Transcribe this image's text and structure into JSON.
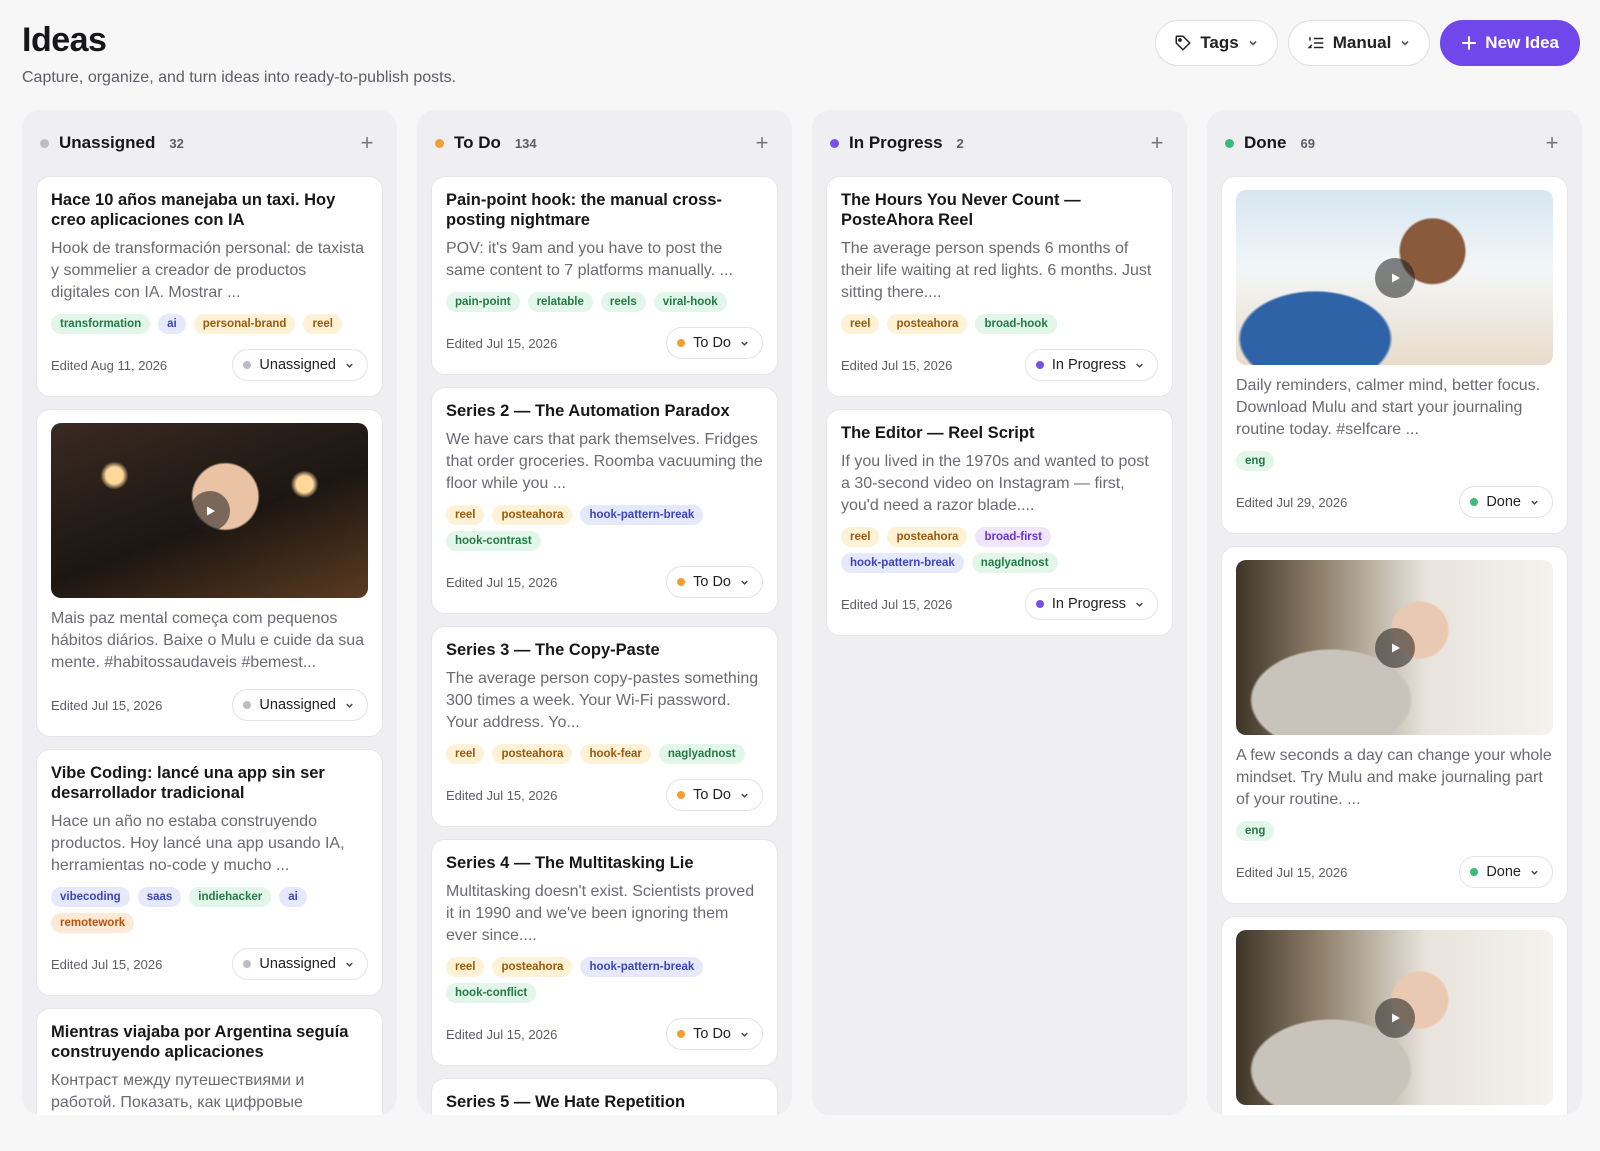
{
  "page": {
    "title": "Ideas",
    "subtitle": "Capture, organize, and turn ideas into ready-to-publish posts."
  },
  "toolbar": {
    "tags_label": "Tags",
    "sort_label": "Manual",
    "new_label": "New Idea"
  },
  "colors": {
    "accent": "#7047eb",
    "unassigned": "#bdbdc4",
    "todo": "#f0a030",
    "inprogress": "#7a4fe8",
    "done": "#3cba78"
  },
  "columns": [
    {
      "title": "Unassigned",
      "count": "32",
      "color": "#bdbdc4",
      "cards": [
        {
          "title": "Hace 10 años manejaba un taxi. Hoy creo aplicaciones con IA",
          "body": "Hook de transformación personal: de taxista y sommelier a creador de productos digitales con IA. Mostrar ...",
          "tags": [
            {
              "t": "transformation",
              "c": "green"
            },
            {
              "t": "ai",
              "c": "blue"
            },
            {
              "t": "personal-brand",
              "c": "yellow"
            },
            {
              "t": "reel",
              "c": "yellow"
            }
          ],
          "edited": "Edited Aug 11, 2026",
          "status": "Unassigned"
        },
        {
          "media": "dinner",
          "body": "Mais paz mental começa com pequenos hábitos diários. Baixe o Mulu e cuide da sua mente. #habitossaudaveis #bemest...",
          "tags": [],
          "edited": "Edited Jul 15, 2026",
          "status": "Unassigned"
        },
        {
          "title": "Vibe Coding: lancé una app sin ser desarrollador tradicional",
          "body": "Hace un año no estaba construyendo productos. Hoy lancé una app usando IA, herramientas no-code y mucho ...",
          "tags": [
            {
              "t": "vibecoding",
              "c": "blue"
            },
            {
              "t": "saas",
              "c": "blue"
            },
            {
              "t": "indiehacker",
              "c": "green"
            },
            {
              "t": "ai",
              "c": "blue"
            },
            {
              "t": "remotework",
              "c": "orange"
            }
          ],
          "edited": "Edited Jul 15, 2026",
          "status": "Unassigned"
        },
        {
          "title": "Mientras viajaba por Argentina seguía construyendo aplicaciones",
          "body": "Контраст между путешествиями и работой. Показать, как цифровые",
          "tags": [],
          "edited": "",
          "status": ""
        }
      ]
    },
    {
      "title": "To Do",
      "count": "134",
      "color": "#f0a030",
      "cards": [
        {
          "title": "Pain-point hook: the manual cross-posting nightmare",
          "body": "POV: it's 9am and you have to post the same content to 7 platforms manually. ...",
          "tags": [
            {
              "t": "pain-point",
              "c": "green"
            },
            {
              "t": "relatable",
              "c": "green"
            },
            {
              "t": "reels",
              "c": "green"
            },
            {
              "t": "viral-hook",
              "c": "green"
            }
          ],
          "edited": "Edited Jul 15, 2026",
          "status": "To Do"
        },
        {
          "title": "Series 2 — The Automation Paradox",
          "body": "We have cars that park themselves. Fridges that order groceries. Roomba vacuuming the floor while you ...",
          "tags": [
            {
              "t": "reel",
              "c": "yellow"
            },
            {
              "t": "posteahora",
              "c": "yellow"
            },
            {
              "t": "hook-pattern-break",
              "c": "blue"
            },
            {
              "t": "hook-contrast",
              "c": "green"
            }
          ],
          "edited": "Edited Jul 15, 2026",
          "status": "To Do"
        },
        {
          "title": "Series 3 — The Copy-Paste",
          "body": "The average person copy-pastes something 300 times a week. Your Wi-Fi password. Your address. Yo...",
          "tags": [
            {
              "t": "reel",
              "c": "yellow"
            },
            {
              "t": "posteahora",
              "c": "yellow"
            },
            {
              "t": "hook-fear",
              "c": "yellow"
            },
            {
              "t": "naglyadnost",
              "c": "green"
            }
          ],
          "edited": "Edited Jul 15, 2026",
          "status": "To Do"
        },
        {
          "title": "Series 4 — The Multitasking Lie",
          "body": "Multitasking doesn't exist. Scientists proved it in 1990 and we've been ignoring them ever since....",
          "tags": [
            {
              "t": "reel",
              "c": "yellow"
            },
            {
              "t": "posteahora",
              "c": "yellow"
            },
            {
              "t": "hook-pattern-break",
              "c": "blue"
            },
            {
              "t": "hook-conflict",
              "c": "green"
            }
          ],
          "edited": "Edited Jul 15, 2026",
          "status": "To Do"
        },
        {
          "title": "Series 5 — We Hate Repetition",
          "body": "",
          "tags": [],
          "edited": "",
          "status": ""
        }
      ]
    },
    {
      "title": "In Progress",
      "count": "2",
      "color": "#7a4fe8",
      "cards": [
        {
          "title": "The Hours You Never Count — PosteAhora Reel",
          "body": "The average person spends 6 months of their life waiting at red lights. 6 months. Just sitting there....",
          "tags": [
            {
              "t": "reel",
              "c": "yellow"
            },
            {
              "t": "posteahora",
              "c": "yellow"
            },
            {
              "t": "broad-hook",
              "c": "green"
            }
          ],
          "edited": "Edited Jul 15, 2026",
          "status": "In Progress"
        },
        {
          "title": "The Editor — Reel Script",
          "body": "If you lived in the 1970s and wanted to post a 30-second video on Instagram — first, you'd need a razor blade....",
          "tags": [
            {
              "t": "reel",
              "c": "yellow"
            },
            {
              "t": "posteahora",
              "c": "yellow"
            },
            {
              "t": "broad-first",
              "c": "purple"
            },
            {
              "t": "hook-pattern-break",
              "c": "blue"
            },
            {
              "t": "naglyadnost",
              "c": "green"
            }
          ],
          "edited": "Edited Jul 15, 2026",
          "status": "In Progress"
        }
      ]
    },
    {
      "title": "Done",
      "count": "69",
      "color": "#3cba78",
      "cards": [
        {
          "media": "beach",
          "body": "Daily reminders, calmer mind, better focus. Download Mulu and start your journaling routine today. #selfcare ...",
          "tags": [
            {
              "t": "eng",
              "c": "green"
            }
          ],
          "edited": "Edited Jul 29, 2026",
          "status": "Done"
        },
        {
          "media": "room",
          "body": "A few seconds a day can change your whole mindset. Try Mulu and make journaling part of your routine. ...",
          "tags": [
            {
              "t": "eng",
              "c": "green"
            }
          ],
          "edited": "Edited Jul 15, 2026",
          "status": "Done"
        },
        {
          "media": "room",
          "body": "",
          "tags": [],
          "edited": "",
          "status": ""
        }
      ]
    }
  ]
}
